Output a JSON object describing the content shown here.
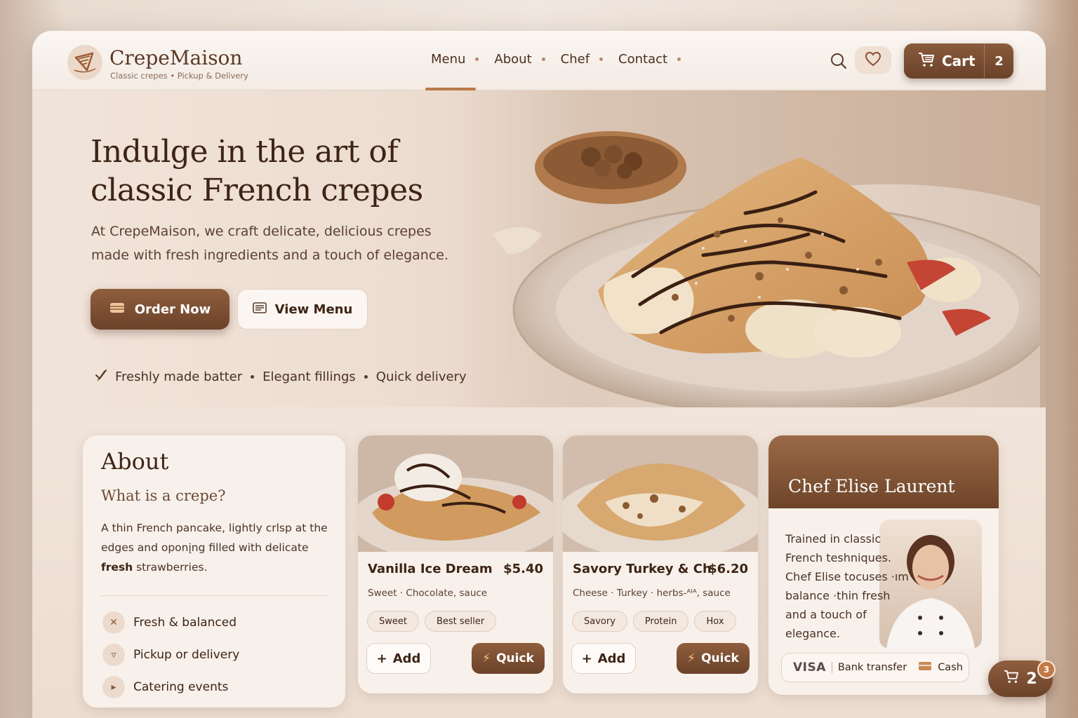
{
  "brand": {
    "name": "CrepeMaison",
    "tagline": "Classic crepes • Pickup & Delivery"
  },
  "nav": {
    "items": [
      {
        "label": "Menu"
      },
      {
        "label": "About"
      },
      {
        "label": "Chef"
      },
      {
        "label": "Contact"
      }
    ],
    "active": "Menu"
  },
  "header": {
    "cart_label": "Cart",
    "cart_count": "2"
  },
  "hero": {
    "title": "Indulge in the art of classic French crepes",
    "description": "At CrepeMaison, we craft delicate, delicious crepes made with fresh ingredients and a touch of elegance.",
    "order_button": "Order Now",
    "view_button": "View Menu",
    "features": [
      "Freshly made batter",
      "Elegant fillings",
      "Quick delivery"
    ]
  },
  "about": {
    "title": "About",
    "subtitle": "What is a crepe?",
    "text_before": "A thin French pancake, lightly crlsp at the edges and oponįng filled with delicate ",
    "text_bold": "fresh",
    "text_after": " strawberries.",
    "list": [
      {
        "label": "Fresh & balanced",
        "icon": "sparkle-icon"
      },
      {
        "label": "Pickup or delivery",
        "icon": "delivery-icon"
      },
      {
        "label": "Catering events",
        "icon": "event-icon"
      }
    ]
  },
  "menu_items": [
    {
      "name": "Vanilla Ice Dream",
      "price": "$5.40",
      "description": "Sweet · Chocolate, sauce",
      "tags": [
        "Sweet",
        "Best seller"
      ],
      "add": "Add",
      "quick": "Quick"
    },
    {
      "name": "Savory Turkey & Ch",
      "price": "$6.20",
      "description": "Cheese · Turkey · herbs-ᴬᴵᴬ, sauce",
      "tags": [
        "Savory",
        "Protein",
        "Hox"
      ],
      "add": "Add",
      "quick": "Quick"
    }
  ],
  "chef": {
    "name": "Chef Elise Laurent",
    "bio": "Trained in classic French teshniques. Chef Elise tocuses ·ım balance ·thin fresh and a touch of elegance.",
    "payments": {
      "visa": "VISA",
      "bank": "Bank transfer",
      "cash": "Cash"
    }
  },
  "floating_cart": {
    "count": "2",
    "badge": "3"
  },
  "colors": {
    "accent": "#7a4c30",
    "background": "#f4ece5",
    "text": "#3d2415"
  }
}
